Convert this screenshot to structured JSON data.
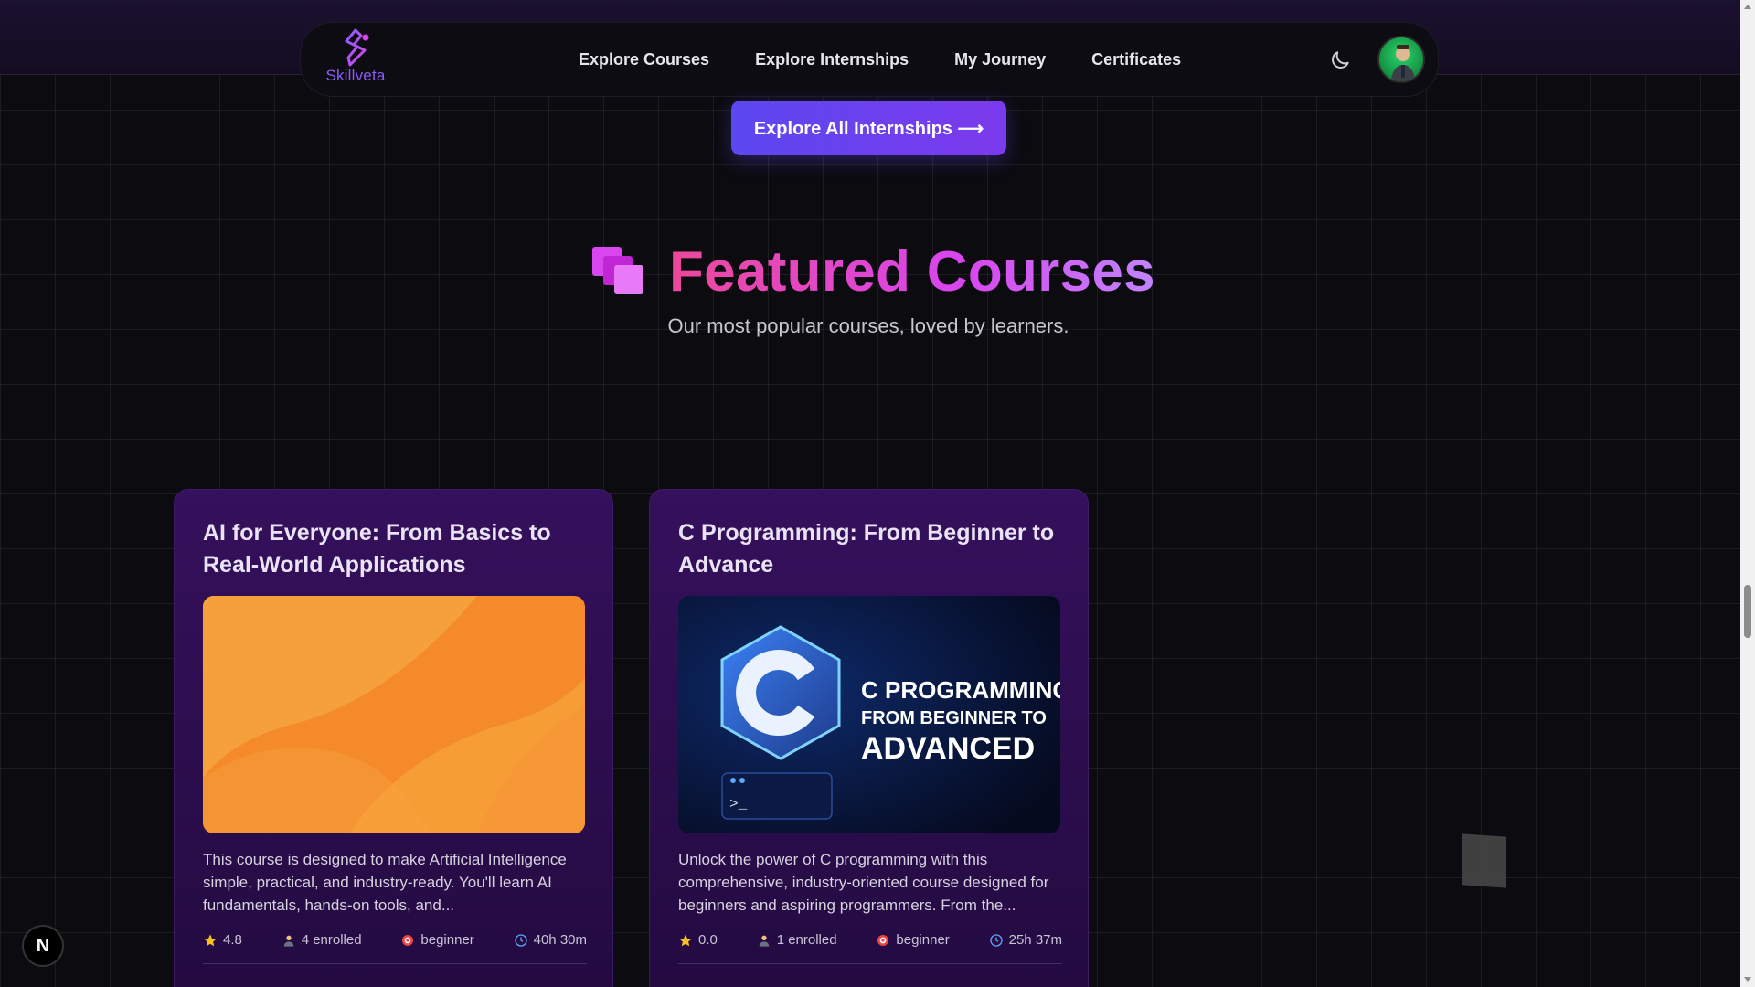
{
  "brand": {
    "name": "Skillveta"
  },
  "nav": {
    "links": [
      {
        "label": "Explore Courses"
      },
      {
        "label": "Explore Internships"
      },
      {
        "label": "My Journey"
      },
      {
        "label": "Certificates"
      }
    ]
  },
  "cta": {
    "label": "Explore All Internships ⟶"
  },
  "section": {
    "title": "Featured Courses",
    "subtitle": "Our most popular courses, loved by learners."
  },
  "courses": [
    {
      "title": "AI for Everyone: From Basics to Real-World Applications",
      "description": "This course is designed to make Artificial Intelligence simple, practical, and industry-ready. You'll learn AI fundamentals, hands-on tools, and...",
      "rating": "4.8",
      "enrolled": "4 enrolled",
      "level": "beginner",
      "duration": "40h 30m"
    },
    {
      "title": "C Programming: From Beginner to Advance",
      "image_text_1": "C PROGRAMMING:",
      "image_text_2": "FROM BEGINNER TO",
      "image_text_3": "ADVANCED",
      "description": "Unlock the power of C programming with this comprehensive, industry-oriented course designed for beginners and aspiring programmers. From the...",
      "rating": "0.0",
      "enrolled": "1 enrolled",
      "level": "beginner",
      "duration": "25h 37m"
    }
  ],
  "badge": {
    "label": "N"
  },
  "colors": {
    "accent": "#7c3aed",
    "title_gradient_start": "#ec4899",
    "card_bg": "#2a0d4b"
  }
}
